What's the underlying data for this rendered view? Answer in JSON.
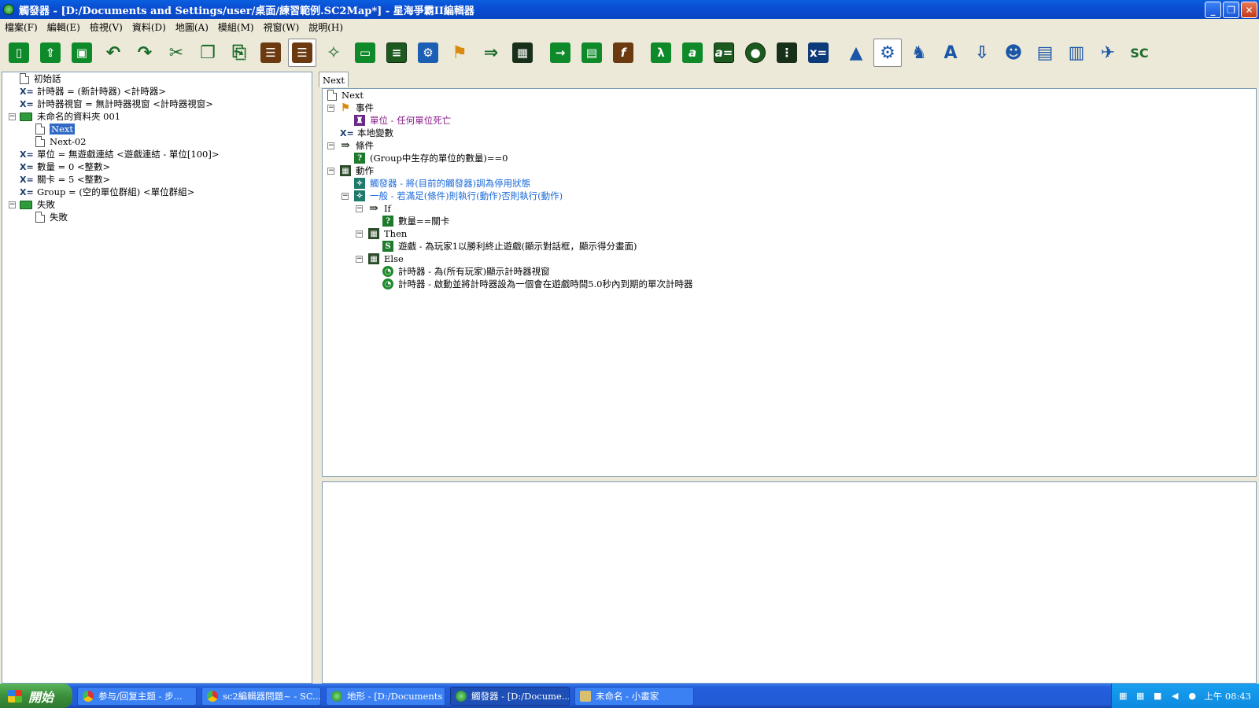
{
  "window": {
    "title": "觸發器 - [D:/Documents and Settings/user/桌面/練習範例.SC2Map*] - 星海爭霸II編輯器",
    "min_label": "_",
    "restore_label": "❐",
    "close_label": "✕"
  },
  "menu": [
    "檔案(F)",
    "編輯(E)",
    "檢視(V)",
    "資料(D)",
    "地圖(A)",
    "模組(M)",
    "視窗(W)",
    "說明(H)"
  ],
  "toolbar_icons": [
    "new-file-icon",
    "open-file-icon",
    "save-icon",
    "undo-icon",
    "redo-icon",
    "cut-icon",
    "copy-icon",
    "paste-icon",
    "trigger-list-icon",
    "trigger-editor-icon",
    "new-trigger-icon",
    "new-folder-icon",
    "new-comment-icon",
    "new-gear-icon",
    "new-event-icon",
    "new-condition-icon",
    "new-action-icon",
    "new-element-icon",
    "new-script-icon",
    "new-function-icon",
    "new-lambda-icon",
    "new-param-icon",
    "new-assign-icon",
    "new-record-icon",
    "new-code-icon",
    "new-variable-icon",
    "terrain-icon",
    "settings-icon",
    "units-icon",
    "text-icon",
    "import-icon",
    "ai-icon",
    "cutscene-icon",
    "film-icon",
    "data-icon",
    "sc-logo-icon"
  ],
  "left_tree": {
    "items": [
      {
        "label": "初始話",
        "type": "doc"
      },
      {
        "label": "計時器 = (新計時器) <計時器>",
        "type": "var"
      },
      {
        "label": "計時器視窗 = 無計時器視窗 <計時器視窗>",
        "type": "var"
      },
      {
        "label": "未命名的資料夾 001",
        "type": "folder"
      },
      {
        "label": "Next",
        "type": "doc"
      },
      {
        "label": "Next-02",
        "type": "doc"
      },
      {
        "label": "單位 = 無遊戲連結 <遊戲連結 - 單位[100]>",
        "type": "var"
      },
      {
        "label": "數量 = 0 <整數>",
        "type": "var"
      },
      {
        "label": "關卡 = 5 <整數>",
        "type": "var"
      },
      {
        "label": "Group = (空的單位群組) <單位群組>",
        "type": "var"
      },
      {
        "label": "失敗",
        "type": "folder"
      },
      {
        "label": "失敗",
        "type": "doc"
      }
    ],
    "var_prefix": "X=",
    "collapse_sign": "−"
  },
  "tab": {
    "label": "Next"
  },
  "trigger_tree": {
    "items": [
      {
        "label": "Next"
      },
      {
        "label": "事件"
      },
      {
        "label": "單位 - 任何單位死亡"
      },
      {
        "label": "本地變數"
      },
      {
        "label": "條件"
      },
      {
        "label": "(Group中生存的單位的數量)==0"
      },
      {
        "label": "動作"
      },
      {
        "label": "觸發器 - 將(目前的觸發器)調為停用狀態"
      },
      {
        "label": "一般 - 若滿足(條件)則執行(動作)否則執行(動作)"
      },
      {
        "label": "If"
      },
      {
        "label": "數量==關卡"
      },
      {
        "label": "Then"
      },
      {
        "label": "遊戲 - 為玩家1以勝利終止遊戲(顯示對話框，顯示得分畫面)"
      },
      {
        "label": "Else"
      },
      {
        "label": "計時器 - 為(所有玩家)顯示計時器視窗"
      },
      {
        "label": "計時器 - 啟動並將計時器設為一個會在遊戲時間5.0秒內到期的單次計時器"
      }
    ]
  },
  "taskbar": {
    "start_label": "開始",
    "tasks": [
      {
        "label": "参与/回复主题 - 步..."
      },
      {
        "label": "sc2編輯器問題~ - SC..."
      },
      {
        "label": "地形 - [D:/Documents ..."
      },
      {
        "label": "觸發器 - [D:/Docume..."
      },
      {
        "label": "未命名 - 小畫家"
      }
    ],
    "clock": "上午 08:43"
  },
  "colors": {
    "titlebar": "#0a4bd0",
    "selection": "#316ac5",
    "event_text": "#8a1a8a",
    "action_text": "#1a6ad8",
    "taskbar": "#225bd6"
  }
}
